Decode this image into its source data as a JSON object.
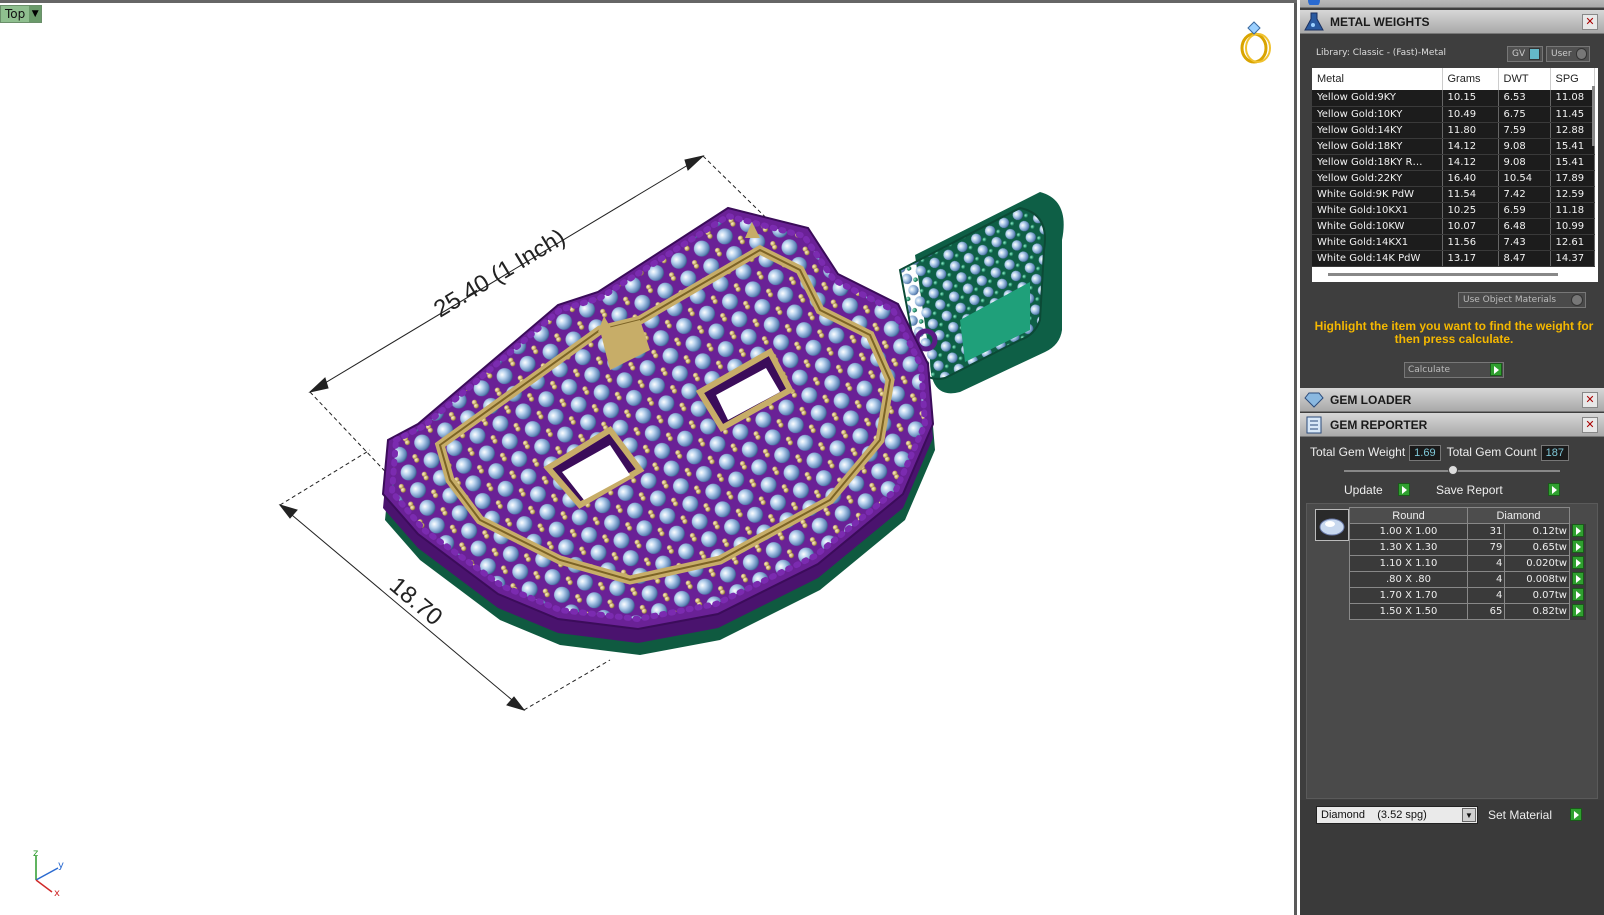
{
  "viewport": {
    "label": "Top",
    "dimension_long": "25.40 (1 Inch)",
    "dimension_short": "18.70",
    "axis_z": "z",
    "axis_y": "y",
    "axis_x": "x"
  },
  "metal_weights": {
    "title": "METAL WEIGHTS",
    "library": "Library: Classic - (Fast)-Metal",
    "gv_label": "GV",
    "user_label": "User",
    "columns": [
      "Metal",
      "Grams",
      "DWT",
      "SPG"
    ],
    "rows": [
      [
        "Yellow Gold:9KY",
        "10.15",
        "6.53",
        "11.08"
      ],
      [
        "Yellow Gold:10KY",
        "10.49",
        "6.75",
        "11.45"
      ],
      [
        "Yellow Gold:14KY",
        "11.80",
        "7.59",
        "12.88"
      ],
      [
        "Yellow Gold:18KY",
        "14.12",
        "9.08",
        "15.41"
      ],
      [
        "Yellow Gold:18KY R…",
        "14.12",
        "9.08",
        "15.41"
      ],
      [
        "Yellow Gold:22KY",
        "16.40",
        "10.54",
        "17.89"
      ],
      [
        "White Gold:9K PdW",
        "11.54",
        "7.42",
        "12.59"
      ],
      [
        "White Gold:10KX1",
        "10.25",
        "6.59",
        "11.18"
      ],
      [
        "White Gold:10KW",
        "10.07",
        "6.48",
        "10.99"
      ],
      [
        "White Gold:14KX1",
        "11.56",
        "7.43",
        "12.61"
      ],
      [
        "White Gold:14K PdW",
        "13.17",
        "8.47",
        "14.37"
      ]
    ],
    "use_object_materials": "Use Object Materials",
    "hint": "Highlight the item you want to find the weight for then press calculate.",
    "calculate": "Calculate"
  },
  "gem_loader": {
    "title": "GEM LOADER"
  },
  "gem_reporter": {
    "title": "GEM REPORTER",
    "total_weight_label": "Total Gem Weight",
    "total_weight_value": "1.69",
    "total_count_label": "Total Gem Count",
    "total_count_value": "187",
    "update": "Update",
    "save_report": "Save Report",
    "col_shape": "Round",
    "col_type": "Diamond",
    "rows": [
      [
        "1.00 X 1.00",
        "31",
        "0.12tw"
      ],
      [
        "1.30 X 1.30",
        "79",
        "0.65tw"
      ],
      [
        "1.10 X 1.10",
        "4",
        "0.020tw"
      ],
      [
        ".80 X .80",
        "4",
        "0.008tw"
      ],
      [
        "1.70 X 1.70",
        "4",
        "0.07tw"
      ],
      [
        "1.50 X 1.50",
        "65",
        "0.82tw"
      ]
    ],
    "material_select": "Diamond    (3.52 spg)",
    "set_material": "Set Material"
  },
  "colors": {
    "panel_bg": "#3e3e3e",
    "hint_text": "#f5b800",
    "metal_purple": "#5b1c86",
    "metal_gold": "#c8b070",
    "bail_green": "#1f8a68",
    "stone_blue": "#9ec2e6"
  }
}
